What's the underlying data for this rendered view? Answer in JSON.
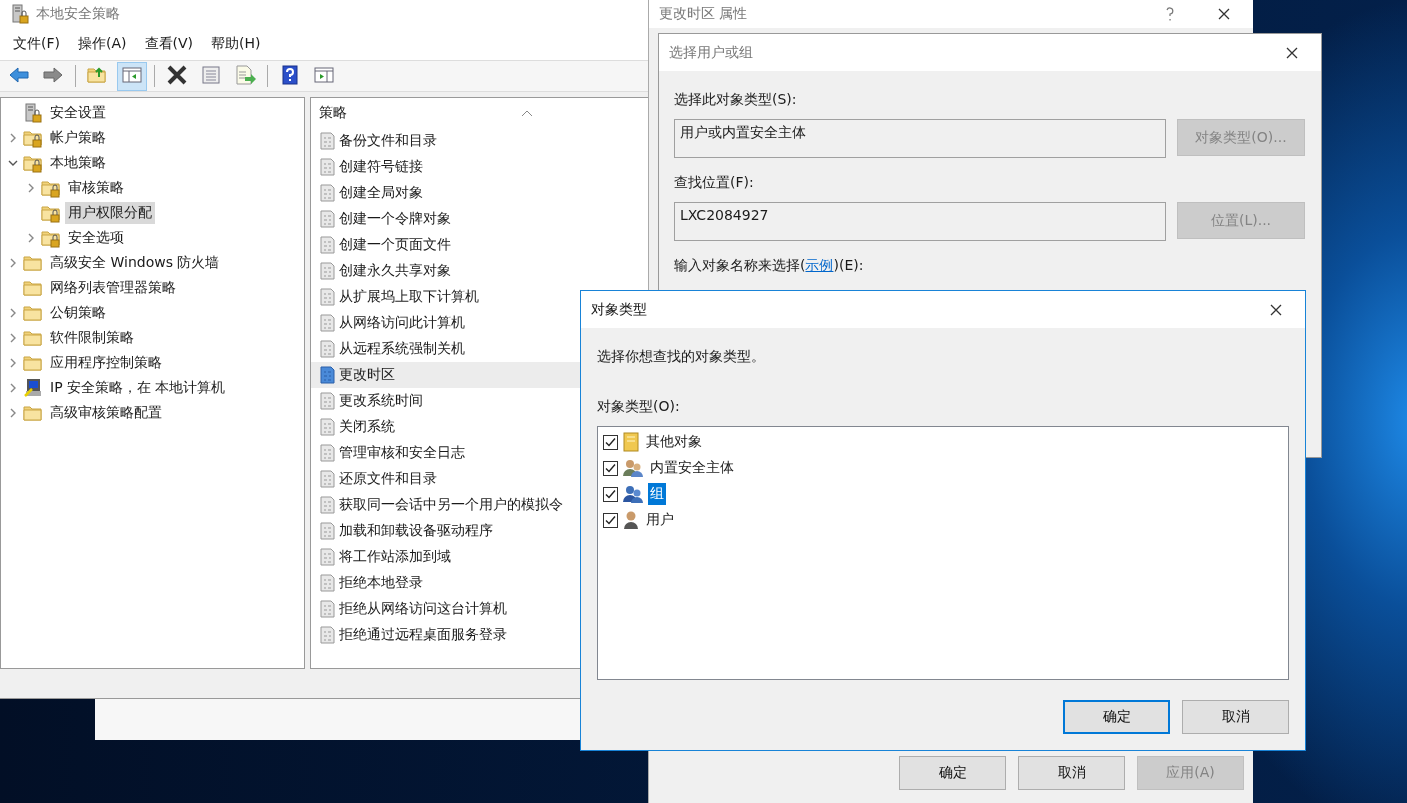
{
  "main_window": {
    "title": "本地安全策略",
    "menu": [
      "文件(F)",
      "操作(A)",
      "查看(V)",
      "帮助(H)"
    ],
    "toolbar": [
      {
        "kind": "back"
      },
      {
        "kind": "forward"
      },
      {
        "kind": "separator"
      },
      {
        "kind": "up"
      },
      {
        "kind": "tree",
        "pressed": true
      },
      {
        "kind": "separator"
      },
      {
        "kind": "delete"
      },
      {
        "kind": "properties"
      },
      {
        "kind": "export"
      },
      {
        "kind": "separator"
      },
      {
        "kind": "help"
      },
      {
        "kind": "pane"
      }
    ],
    "tree": {
      "label": "安全设置",
      "children": [
        {
          "label": "帐户策略",
          "kind": "locked-folder",
          "expandable": true,
          "expanded": false,
          "selected": false
        },
        {
          "label": "本地策略",
          "kind": "locked-folder",
          "expandable": true,
          "expanded": true,
          "selected": false,
          "children": [
            {
              "label": "审核策略",
              "kind": "locked-folder",
              "expandable": true,
              "expanded": false,
              "selected": false
            },
            {
              "label": "用户权限分配",
              "kind": "locked-folder",
              "expandable": false,
              "selected": true
            },
            {
              "label": "安全选项",
              "kind": "locked-folder",
              "expandable": true,
              "expanded": false,
              "selected": false
            }
          ]
        },
        {
          "label": "高级安全 Windows 防火墙",
          "kind": "folder",
          "expandable": true,
          "expanded": false,
          "selected": false
        },
        {
          "label": "网络列表管理器策略",
          "kind": "folder",
          "expandable": false,
          "selected": false
        },
        {
          "label": "公钥策略",
          "kind": "folder",
          "expandable": true,
          "expanded": false,
          "selected": false
        },
        {
          "label": "软件限制策略",
          "kind": "folder",
          "expandable": true,
          "expanded": false,
          "selected": false
        },
        {
          "label": "应用程序控制策略",
          "kind": "folder",
          "expandable": true,
          "expanded": false,
          "selected": false
        },
        {
          "label": "IP 安全策略，在 本地计算机",
          "kind": "computer",
          "expandable": true,
          "expanded": false,
          "selected": false
        },
        {
          "label": "高级审核策略配置",
          "kind": "folder",
          "expandable": true,
          "expanded": false,
          "selected": false
        }
      ]
    },
    "list": {
      "column": "策略",
      "rows": [
        {
          "label": "备份文件和目录",
          "selected": false
        },
        {
          "label": "创建符号链接",
          "selected": false
        },
        {
          "label": "创建全局对象",
          "selected": false
        },
        {
          "label": "创建一个令牌对象",
          "selected": false
        },
        {
          "label": "创建一个页面文件",
          "selected": false
        },
        {
          "label": "创建永久共享对象",
          "selected": false
        },
        {
          "label": "从扩展坞上取下计算机",
          "selected": false
        },
        {
          "label": "从网络访问此计算机",
          "selected": false
        },
        {
          "label": "从远程系统强制关机",
          "selected": false
        },
        {
          "label": "更改时区",
          "selected": true
        },
        {
          "label": "更改系统时间",
          "selected": false
        },
        {
          "label": "关闭系统",
          "selected": false
        },
        {
          "label": "管理审核和安全日志",
          "selected": false
        },
        {
          "label": "还原文件和目录",
          "selected": false
        },
        {
          "label": "获取同一会话中另一个用户的模拟令",
          "selected": false
        },
        {
          "label": "加载和卸载设备驱动程序",
          "selected": false
        },
        {
          "label": "将工作站添加到域",
          "selected": false
        },
        {
          "label": "拒绝本地登录",
          "selected": false
        },
        {
          "label": "拒绝从网络访问这台计算机",
          "selected": false
        },
        {
          "label": "拒绝通过远程桌面服务登录",
          "selected": false
        }
      ]
    }
  },
  "properties_window": {
    "title": "更改时区 属性",
    "buttons": [
      {
        "label": "确定",
        "disabled": false
      },
      {
        "label": "取消",
        "disabled": false
      },
      {
        "label": "应用(A)",
        "disabled": true
      }
    ]
  },
  "select_dialog": {
    "title": "选择用户或组",
    "object_type_label": "选择此对象类型(S):",
    "object_type_value": "用户或内置安全主体",
    "object_type_button": {
      "label": "对象类型(O)...",
      "disabled": true
    },
    "location_label": "查找位置(F):",
    "location_value": "LXC2084927",
    "location_button": {
      "label": "位置(L)...",
      "disabled": true
    },
    "name_label_prefix": "输入对象名称来选择(",
    "name_label_link": "示例",
    "name_label_suffix": ")(E):"
  },
  "object_types_dialog": {
    "title": "对象类型",
    "prompt": "选择你想查找的对象类型。",
    "list_label": "对象类型(O):",
    "items": [
      {
        "label": "其他对象",
        "kind": "other",
        "checked": true,
        "selected": false
      },
      {
        "label": "内置安全主体",
        "kind": "builtin",
        "checked": true,
        "selected": false
      },
      {
        "label": "组",
        "kind": "group",
        "checked": true,
        "selected": true
      },
      {
        "label": "用户",
        "kind": "user",
        "checked": true,
        "selected": false
      }
    ],
    "buttons": [
      {
        "label": "确定",
        "default": true
      },
      {
        "label": "取消",
        "default": false
      }
    ]
  }
}
